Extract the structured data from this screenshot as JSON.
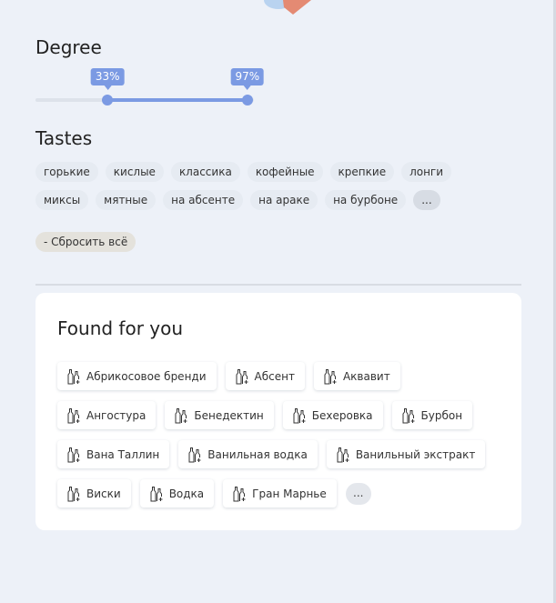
{
  "colors": {
    "accent": "#7b9ae3",
    "background": "#edf1f8",
    "card": "#ffffff"
  },
  "degree": {
    "title": "Degree",
    "min_value": 33,
    "max_value": 97,
    "min_label": "33%",
    "max_label": "97%"
  },
  "tastes": {
    "title": "Tastes",
    "chips": [
      "горькие",
      "кислые",
      "классика",
      "кофейные",
      "крепкие",
      "лонги",
      "миксы",
      "мятные",
      "на абсенте",
      "на араке",
      "на бурбоне"
    ],
    "more_label": "..."
  },
  "reset_label": "- Сбросить всё",
  "found": {
    "title": "Found for you",
    "item_icon": "bottles-icon",
    "items": [
      "Абрикосовое бренди",
      "Абсент",
      "Аквавит",
      "Ангостура",
      "Бенедектин",
      "Бехеровка",
      "Бурбон",
      "Вана Таллин",
      "Ванильная водка",
      "Ванильный экстракт",
      "Виски",
      "Водка",
      "Гран Марнье"
    ],
    "more_label": "..."
  }
}
